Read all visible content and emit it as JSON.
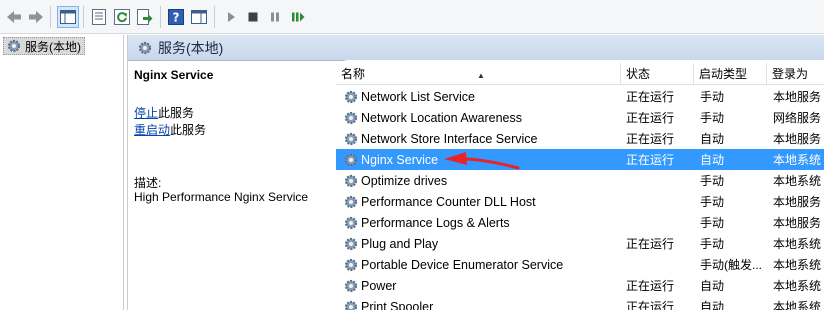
{
  "toolbar": {
    "buttons": [
      {
        "name": "back-icon"
      },
      {
        "name": "forward-icon"
      },
      {
        "name": "show-hide-console-tree-icon"
      },
      {
        "name": "properties-icon"
      },
      {
        "name": "refresh-icon"
      },
      {
        "name": "export-list-icon"
      },
      {
        "name": "help-icon"
      },
      {
        "name": "show-hide-action-pane-icon"
      },
      {
        "name": "start-service-icon"
      },
      {
        "name": "stop-service-icon"
      },
      {
        "name": "pause-service-icon"
      },
      {
        "name": "restart-service-icon"
      }
    ]
  },
  "tree": {
    "item_label": "服务(本地)"
  },
  "main": {
    "header_label": "服务(本地)",
    "selected_service_title": "Nginx Service",
    "stop_link": "停止",
    "stop_suffix": "此服务",
    "restart_link": "重启动",
    "restart_suffix": "此服务",
    "description_label": "描述:",
    "description_text": "High Performance Nginx Service"
  },
  "table": {
    "headers": {
      "name": "名称",
      "status": "状态",
      "startup": "启动类型",
      "logon": "登录为"
    },
    "rows": [
      {
        "name": "Network List Service",
        "status": "正在运行",
        "startup": "手动",
        "logon": "本地服务"
      },
      {
        "name": "Network Location Awareness",
        "status": "正在运行",
        "startup": "手动",
        "logon": "网络服务"
      },
      {
        "name": "Network Store Interface Service",
        "status": "正在运行",
        "startup": "自动",
        "logon": "本地服务"
      },
      {
        "name": "Nginx Service",
        "status": "正在运行",
        "startup": "自动",
        "logon": "本地系统",
        "selected": true
      },
      {
        "name": "Optimize drives",
        "status": "",
        "startup": "手动",
        "logon": "本地系统"
      },
      {
        "name": "Performance Counter DLL Host",
        "status": "",
        "startup": "手动",
        "logon": "本地服务"
      },
      {
        "name": "Performance Logs & Alerts",
        "status": "",
        "startup": "手动",
        "logon": "本地服务"
      },
      {
        "name": "Plug and Play",
        "status": "正在运行",
        "startup": "手动",
        "logon": "本地系统"
      },
      {
        "name": "Portable Device Enumerator Service",
        "status": "",
        "startup": "手动(触发...",
        "logon": "本地系统"
      },
      {
        "name": "Power",
        "status": "正在运行",
        "startup": "自动",
        "logon": "本地系统"
      },
      {
        "name": "Print Spooler",
        "status": "正在运行",
        "startup": "自动",
        "logon": "本地系统"
      }
    ]
  },
  "colors": {
    "selection": "#3399ff",
    "annotation_arrow": "#e8242b",
    "link": "#0645ad"
  }
}
